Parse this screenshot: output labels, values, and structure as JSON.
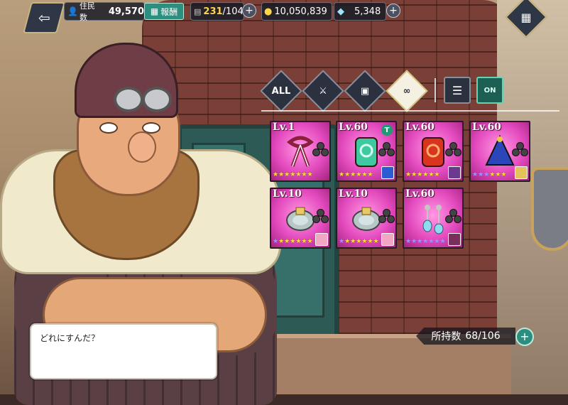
{
  "topbar": {
    "residents_label": "住民数",
    "residents_value": "49,570",
    "report_label": "報酬",
    "capacity_value": "231",
    "capacity_max": "/104",
    "gold_value": "10,050,839",
    "crystal_value": "5,348"
  },
  "filters": [
    {
      "label": "ALL",
      "icon": "all-filter",
      "active": false
    },
    {
      "label": "",
      "icon": "weapon-icon",
      "active": false
    },
    {
      "label": "",
      "icon": "armor-icon",
      "active": false
    },
    {
      "label": "",
      "icon": "accessory-icon",
      "active": true
    }
  ],
  "tools": {
    "sort_icon": "sort-icon",
    "filter_on_label": "ON"
  },
  "items": [
    {
      "level": "Lv.1",
      "icon": "ribbon-item",
      "stars_gold": 7,
      "stars_purple": 0,
      "badge": "",
      "colors": {
        "main": "#8a1f3e",
        "accent": "#ffffff"
      }
    },
    {
      "level": "Lv.60",
      "icon": "emerald-tag",
      "stars_gold": 6,
      "stars_purple": 0,
      "badge": "T",
      "colors": {
        "main": "#3ec9a1",
        "accent": "#d8fff3"
      }
    },
    {
      "level": "Lv.60",
      "icon": "red-tag",
      "stars_gold": 6,
      "stars_purple": 0,
      "badge": "",
      "colors": {
        "main": "#d8341f",
        "accent": "#ffb06a"
      }
    },
    {
      "level": "Lv.60",
      "icon": "blue-cape",
      "stars_gold": 3,
      "stars_purple": 3,
      "badge": "",
      "colors": {
        "main": "#2a46b8",
        "accent": "#e9c64a"
      }
    },
    {
      "level": "Lv.10",
      "icon": "bracelet",
      "stars_gold": 6,
      "stars_purple": 1,
      "badge": "",
      "colors": {
        "main": "#b7c6c7",
        "accent": "#e9c86a"
      }
    },
    {
      "level": "Lv.10",
      "icon": "bracelet",
      "stars_gold": 6,
      "stars_purple": 1,
      "badge": "",
      "colors": {
        "main": "#b7c6c7",
        "accent": "#e9c86a"
      }
    },
    {
      "level": "Lv.60",
      "icon": "earrings",
      "stars_gold": 0,
      "stars_purple": 7,
      "badge": "",
      "colors": {
        "main": "#8fdbf0",
        "accent": "#c5c5c5"
      }
    }
  ],
  "inventory": {
    "label": "所持数",
    "value": "68/106"
  },
  "dialog": {
    "text": "どれにすんだ？"
  }
}
